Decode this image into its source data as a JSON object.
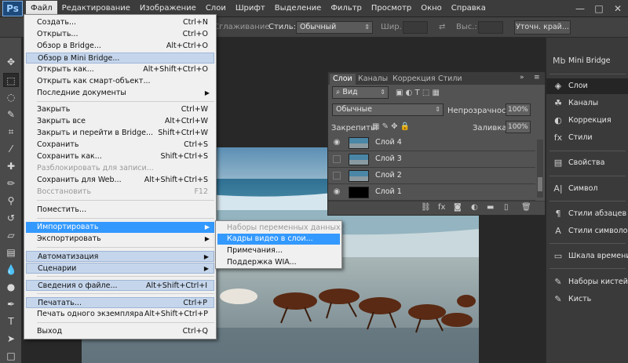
{
  "menubar": {
    "logo": "Ps",
    "items": [
      "Файл",
      "Редактирование",
      "Изображение",
      "Слои",
      "Шрифт",
      "Выделение",
      "Фильтр",
      "Просмотр",
      "Окно",
      "Справка"
    ],
    "window_controls": [
      "—",
      "□",
      "✕"
    ]
  },
  "options_bar": {
    "smoothing": "Сглаживание",
    "style_label": "Стиль:",
    "style_value": "Обычный",
    "width_label": "Шир.:",
    "height_label": "Выс.:",
    "refine_button": "Уточн. край..."
  },
  "file_menu": {
    "items": [
      {
        "label": "Создать...",
        "shortcut": "Ctrl+N"
      },
      {
        "label": "Открыть...",
        "shortcut": "Ctrl+O"
      },
      {
        "label": "Обзор в Bridge...",
        "shortcut": "Alt+Ctrl+O"
      },
      {
        "label": "Обзор в Mini Bridge...",
        "shortcut": ""
      },
      {
        "label": "Открыть как...",
        "shortcut": "Alt+Shift+Ctrl+O"
      },
      {
        "label": "Открыть как смарт-объект...",
        "shortcut": ""
      },
      {
        "label": "Последние документы",
        "shortcut": ""
      },
      {
        "label": "Закрыть",
        "shortcut": "Ctrl+W"
      },
      {
        "label": "Закрыть все",
        "shortcut": "Alt+Ctrl+W"
      },
      {
        "label": "Закрыть и перейти в Bridge...",
        "shortcut": "Shift+Ctrl+W"
      },
      {
        "label": "Сохранить",
        "shortcut": "Ctrl+S"
      },
      {
        "label": "Сохранить как...",
        "shortcut": "Shift+Ctrl+S"
      },
      {
        "label": "Разблокировать для записи...",
        "shortcut": ""
      },
      {
        "label": "Сохранить для Web...",
        "shortcut": "Alt+Shift+Ctrl+S"
      },
      {
        "label": "Восстановить",
        "shortcut": "F12"
      },
      {
        "label": "Поместить...",
        "shortcut": ""
      },
      {
        "label": "Импортировать",
        "shortcut": ""
      },
      {
        "label": "Экспортировать",
        "shortcut": ""
      },
      {
        "label": "Автоматизация",
        "shortcut": ""
      },
      {
        "label": "Сценарии",
        "shortcut": ""
      },
      {
        "label": "Сведения о файле...",
        "shortcut": "Alt+Shift+Ctrl+I"
      },
      {
        "label": "Печатать...",
        "shortcut": "Ctrl+P"
      },
      {
        "label": "Печать одного экземпляра",
        "shortcut": "Alt+Shift+Ctrl+P"
      },
      {
        "label": "Выход",
        "shortcut": "Ctrl+Q"
      }
    ]
  },
  "import_submenu": {
    "items": [
      "Наборы переменных данных...",
      "Кадры видео в слои...",
      "Примечания...",
      "Поддержка WIA..."
    ]
  },
  "layers_panel": {
    "tabs": [
      "Слои",
      "Каналы",
      "Коррекция",
      "Стили"
    ],
    "kind_filter": "Вид",
    "blend_mode": "Обычные",
    "opacity_label": "Непрозрачность:",
    "opacity_value": "100%",
    "lock_label": "Закрепить:",
    "fill_label": "Заливка:",
    "fill_value": "100%",
    "layers": [
      {
        "name": "Слой 4",
        "visible": true
      },
      {
        "name": "Слой 3",
        "visible": false
      },
      {
        "name": "Слой 2",
        "visible": false
      },
      {
        "name": "Слой 1",
        "visible": true
      }
    ]
  },
  "dock": {
    "items": [
      "Mini Bridge",
      "Слои",
      "Каналы",
      "Коррекция",
      "Стили",
      "Свойства",
      "Символ",
      "Стили абзацев",
      "Стили символов",
      "Шкала времени",
      "Наборы кистей",
      "Кисть"
    ]
  }
}
